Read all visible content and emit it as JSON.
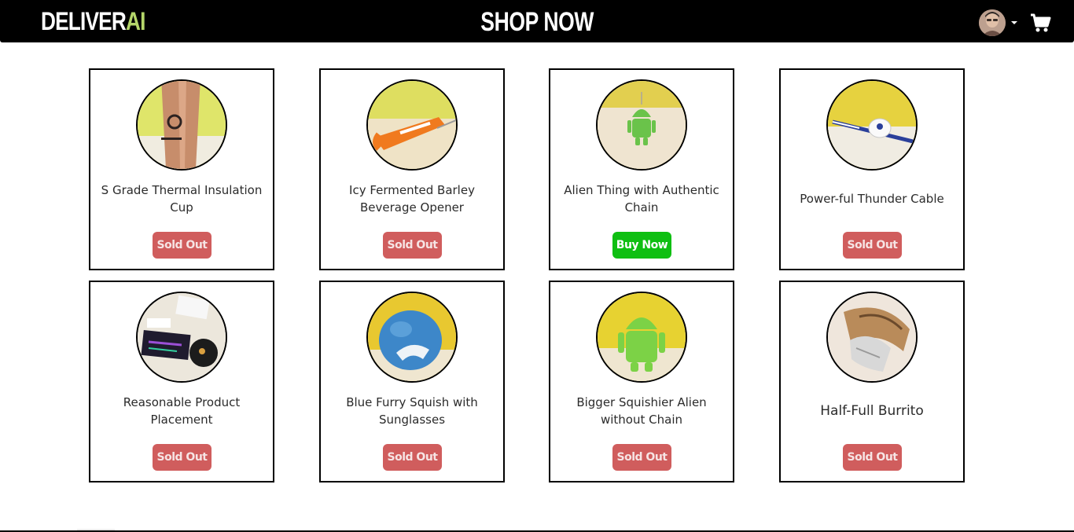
{
  "nav": {
    "brand_main": "DELIVER",
    "brand_accent": "AI",
    "title": "SHOP NOW"
  },
  "icons": {
    "profile": "user-avatar",
    "dropdown": "chevron-down-icon",
    "cart": "shopping-cart-icon"
  },
  "colors": {
    "sold_out": "#d05d5d",
    "buy_now": "#0fbf12",
    "brand_accent": "#b5d66a",
    "navbar": "#000000"
  },
  "products": [
    {
      "name": "S Grade Thermal Insulation Cup",
      "action": "Sold Out",
      "status": "sold_out"
    },
    {
      "name": "Icy Fermented Barley Beverage Opener",
      "action": "Sold Out",
      "status": "sold_out"
    },
    {
      "name": "Alien Thing with Authentic Chain",
      "action": "Buy Now",
      "status": "available"
    },
    {
      "name": "Power-ful Thunder Cable",
      "action": "Sold Out",
      "status": "sold_out"
    },
    {
      "name": "Reasonable Product Placement",
      "action": "Sold Out",
      "status": "sold_out"
    },
    {
      "name": "Blue Furry Squish with Sunglasses",
      "action": "Sold Out",
      "status": "sold_out"
    },
    {
      "name": "Bigger Squishier Alien without Chain",
      "action": "Sold Out",
      "status": "sold_out"
    },
    {
      "name": "Half-Full Burrito",
      "action": "Sold Out",
      "status": "sold_out"
    }
  ]
}
